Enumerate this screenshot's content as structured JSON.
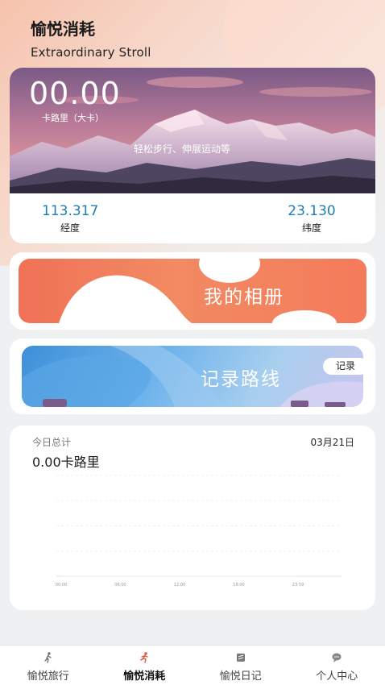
{
  "header": {
    "title": "愉悦消耗",
    "subtitle": "Extraordinary Stroll"
  },
  "hero": {
    "calories_value": "00.00",
    "calories_unit_label": "卡路里（大卡）",
    "caption": "轻松步行、伸展运动等",
    "longitude_value": "113.317",
    "longitude_label": "经度",
    "latitude_value": "23.130",
    "latitude_label": "纬度"
  },
  "album": {
    "label": "我的相册"
  },
  "route": {
    "label": "记录路线",
    "record_button": "记录"
  },
  "stats": {
    "label": "今日总计",
    "date": "03月21日",
    "total": "0.00卡路里"
  },
  "chart_data": {
    "type": "line",
    "categories": [
      "00:00",
      "06:00",
      "12:00",
      "18:00",
      "23:59"
    ],
    "series": [
      {
        "values": [
          0,
          0,
          0,
          0,
          0
        ]
      }
    ],
    "xlabel": "",
    "ylabel": "",
    "grid": true
  },
  "bottom_nav": {
    "items": [
      {
        "label": "愉悦旅行",
        "icon": "walking-person-icon",
        "active": false
      },
      {
        "label": "愉悦消耗",
        "icon": "running-person-icon",
        "active": true
      },
      {
        "label": "愉悦日记",
        "icon": "diary-icon",
        "active": false
      },
      {
        "label": "个人中心",
        "icon": "chat-bubble-icon",
        "active": false
      }
    ]
  },
  "colors": {
    "accent_blue": "#1e7fb8",
    "active_nav": "#e0533b",
    "album_orange": "#f07256",
    "route_blue": "#3d8fd8"
  }
}
